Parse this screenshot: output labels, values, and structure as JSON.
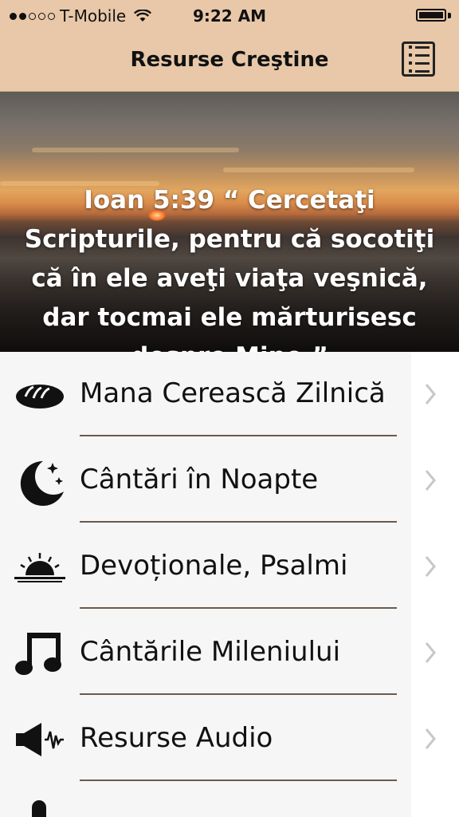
{
  "status_bar": {
    "carrier": "T-Mobile",
    "time": "9:22 AM",
    "signal_filled": 2,
    "signal_total": 5
  },
  "nav": {
    "title": "Resurse Creştine",
    "menu_icon": "list-icon"
  },
  "hero": {
    "verse": "Ioan 5:39 “ Cercetaţi Scripturile, pentru că socotiţi că în ele aveţi viaţa veşnică, dar tocmai ele mărturisesc despre Mine.”"
  },
  "menu_items": [
    {
      "label": "Mana Cerească Zilnică",
      "icon": "bread-icon"
    },
    {
      "label": "Cântări în Noapte",
      "icon": "moon-stars-icon"
    },
    {
      "label": "Devoționale, Psalmi",
      "icon": "sunrise-icon"
    },
    {
      "label": "Cântările Mileniului",
      "icon": "music-note-icon"
    },
    {
      "label": "Resurse Audio",
      "icon": "speaker-icon"
    }
  ],
  "colors": {
    "header_bg": "#e8c8a8",
    "row_bg": "#f6f6f6",
    "divider": "#6a5a4e"
  }
}
